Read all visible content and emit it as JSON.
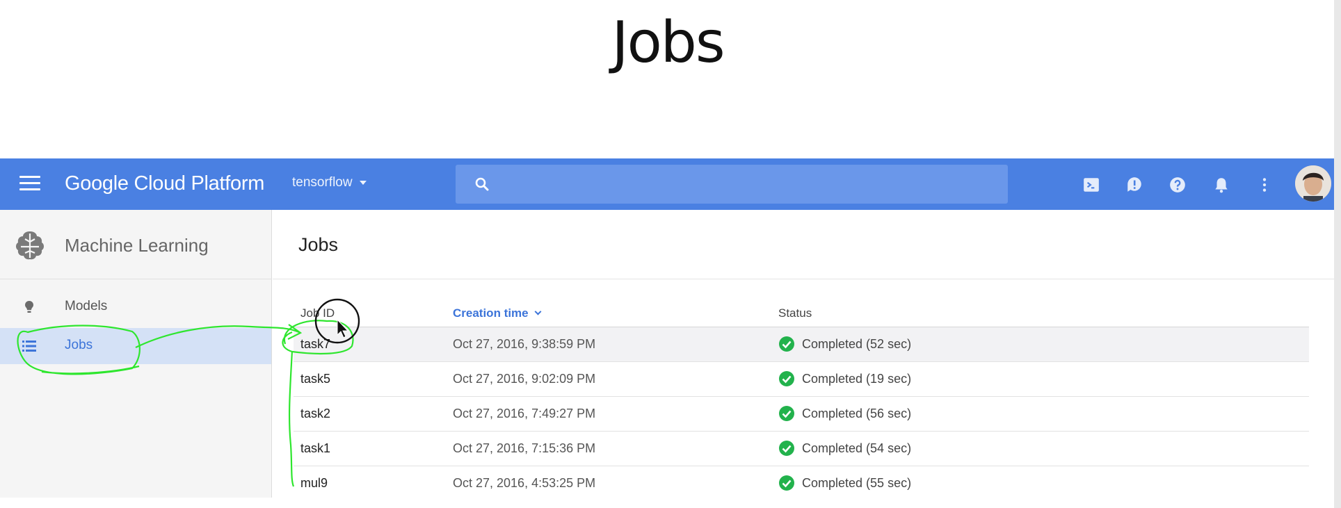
{
  "slide": {
    "title": "Jobs"
  },
  "topbar": {
    "brand": "Google Cloud Platform",
    "project": "tensorflow",
    "search_placeholder": "",
    "icons": [
      "menu-icon",
      "search-icon",
      "cloud-shell-icon",
      "feedback-icon",
      "help-icon",
      "notifications-icon",
      "more-vert-icon",
      "avatar"
    ]
  },
  "sidebar": {
    "title": "Machine Learning",
    "items": [
      {
        "label": "Models",
        "icon": "lightbulb-icon",
        "active": false
      },
      {
        "label": "Jobs",
        "icon": "list-icon",
        "active": true
      }
    ]
  },
  "main": {
    "title": "Jobs",
    "columns": [
      "Job ID",
      "Creation time",
      "Status"
    ],
    "sorted_column": "Creation time",
    "rows": [
      {
        "job_id": "task7",
        "created": "Oct 27, 2016, 9:38:59 PM",
        "status": "Completed (52 sec)"
      },
      {
        "job_id": "task5",
        "created": "Oct 27, 2016, 9:02:09 PM",
        "status": "Completed (19 sec)"
      },
      {
        "job_id": "task2",
        "created": "Oct 27, 2016, 7:49:27 PM",
        "status": "Completed (56 sec)"
      },
      {
        "job_id": "task1",
        "created": "Oct 27, 2016, 7:15:36 PM",
        "status": "Completed (54 sec)"
      },
      {
        "job_id": "mul9",
        "created": "Oct 27, 2016, 4:53:25 PM",
        "status": "Completed (55 sec)"
      }
    ]
  },
  "colors": {
    "topbar": "#4a80e2",
    "accent": "#3c74d9",
    "success": "#22b24c",
    "annotation": "#2ee62e"
  }
}
